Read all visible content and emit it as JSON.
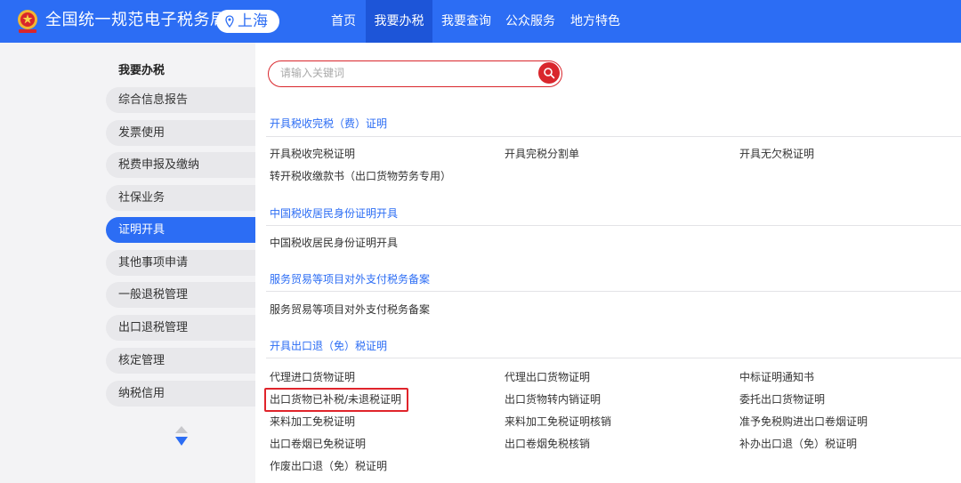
{
  "header": {
    "site_title": "全国统一规范电子税务局",
    "region": "上海",
    "nav": [
      "首页",
      "我要办税",
      "我要查询",
      "公众服务",
      "地方特色"
    ],
    "active_nav": "我要办税",
    "brand_color": "#2c6df4"
  },
  "sidebar": {
    "heading": "我要办税",
    "items": [
      "综合信息报告",
      "发票使用",
      "税费申报及缴纳",
      "社保业务",
      "证明开具",
      "其他事项申请",
      "一般退税管理",
      "出口退税管理",
      "核定管理",
      "纳税信用"
    ],
    "active_item": "证明开具"
  },
  "search": {
    "placeholder": "请输入关键词",
    "accent_color": "#d9262c"
  },
  "sections": [
    {
      "title": "开具税收完税（费）证明",
      "links": [
        "开具税收完税证明",
        "开具完税分割单",
        "开具无欠税证明",
        "转开税收缴款书（出口货物劳务专用）"
      ]
    },
    {
      "title": "中国税收居民身份证明开具",
      "links": [
        "中国税收居民身份证明开具"
      ]
    },
    {
      "title": "服务贸易等项目对外支付税务备案",
      "links": [
        "服务贸易等项目对外支付税务备案"
      ]
    },
    {
      "title": "开具出口退（免）税证明",
      "links": [
        "代理进口货物证明",
        "代理出口货物证明",
        "中标证明通知书",
        "出口货物已补税/未退税证明",
        "出口货物转内销证明",
        "委托出口货物证明",
        "来料加工免税证明",
        "来料加工免税证明核销",
        "准予免税购进出口卷烟证明",
        "出口卷烟已免税证明",
        "出口卷烟免税核销",
        "补办出口退（免）税证明",
        "作废出口退（免）税证明"
      ],
      "highlighted_link": "出口货物已补税/未退税证明"
    }
  ],
  "icons": [
    "national-emblem-icon",
    "location-pin-icon",
    "search-icon",
    "sort-arrows-icon"
  ]
}
